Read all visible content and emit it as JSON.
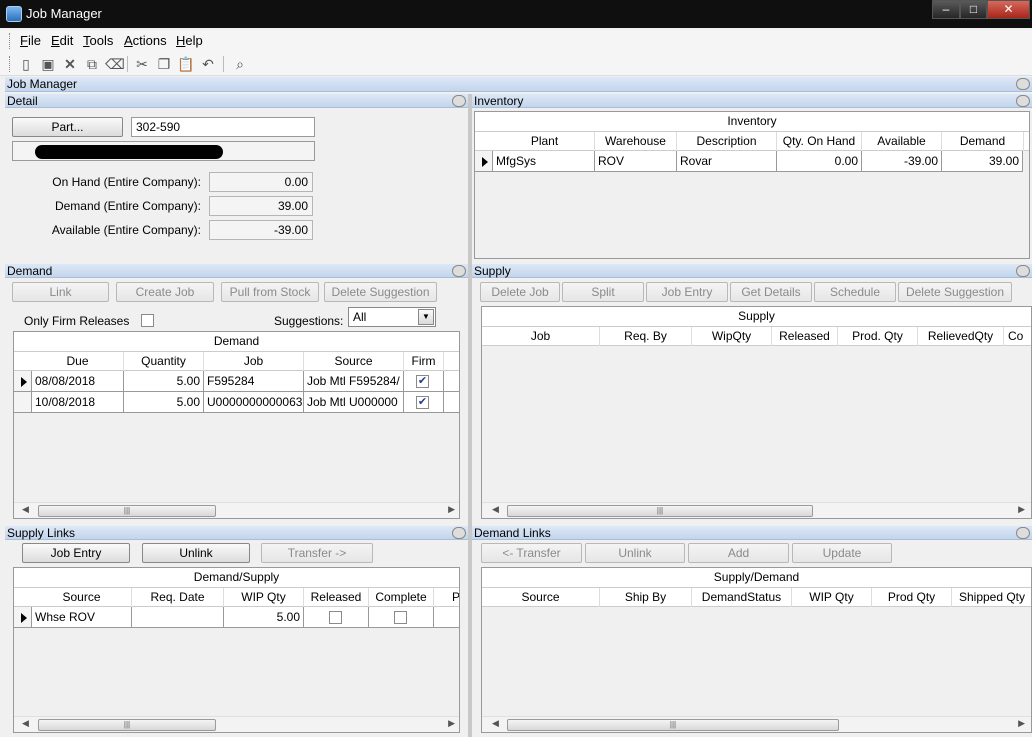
{
  "window": {
    "title": "Job Manager"
  },
  "menu": [
    "File",
    "Edit",
    "Tools",
    "Actions",
    "Help"
  ],
  "toolbar_icons": [
    "new-icon",
    "save-icon",
    "delete-icon",
    "attach-icon",
    "clear-icon",
    "cut-icon",
    "copy-icon",
    "paste-icon",
    "undo-icon",
    "find-icon"
  ],
  "main_header": "Job Manager",
  "detail": {
    "header": "Detail",
    "part_button": "Part...",
    "part_value": "302-590",
    "on_hand_label": "On Hand (Entire Company):",
    "on_hand": "0.00",
    "demand_label": "Demand (Entire Company):",
    "demand": "39.00",
    "available_label": "Available (Entire Company):",
    "available": "-39.00"
  },
  "inventory": {
    "header": "Inventory",
    "caption": "Inventory",
    "columns": [
      "Plant",
      "Warehouse",
      "Description",
      "Qty. On Hand",
      "Available",
      "Demand"
    ],
    "rows": [
      {
        "plant": "MfgSys",
        "warehouse": "ROV",
        "description": "Rovar",
        "qty_on_hand": "0.00",
        "available": "-39.00",
        "demand": "39.00"
      }
    ]
  },
  "demand": {
    "header": "Demand",
    "buttons": [
      "Link",
      "Create Job",
      "Pull from Stock",
      "Delete Suggestion"
    ],
    "only_firm_label": "Only Firm Releases",
    "suggestions_label": "Suggestions:",
    "suggestions_value": "All",
    "caption": "Demand",
    "columns": [
      "Due",
      "Quantity",
      "Job",
      "Source",
      "Firm"
    ],
    "rows": [
      {
        "due": "08/08/2018",
        "quantity": "5.00",
        "job": "F595284",
        "source": "Job Mtl F595284/",
        "firm": true
      },
      {
        "due": "10/08/2018",
        "quantity": "5.00",
        "job": "U0000000000063",
        "source": "Job Mtl U000000",
        "firm": true
      }
    ]
  },
  "supply": {
    "header": "Supply",
    "buttons": [
      "Delete Job",
      "Split",
      "Job Entry",
      "Get Details",
      "Schedule",
      "Delete Suggestion"
    ],
    "caption": "Supply",
    "columns": [
      "Job",
      "Req. By",
      "WipQty",
      "Released",
      "Prod. Qty",
      "RelievedQty",
      "Co"
    ]
  },
  "supply_links": {
    "header": "Supply Links",
    "buttons": [
      "Job Entry",
      "Unlink",
      "Transfer ->"
    ],
    "caption": "Demand/Supply",
    "columns": [
      "Source",
      "Req. Date",
      "WIP Qty",
      "Released",
      "Complete",
      "P"
    ],
    "rows": [
      {
        "source": "Whse ROV",
        "req_date": "",
        "wip_qty": "5.00",
        "released": false,
        "complete": false
      }
    ]
  },
  "demand_links": {
    "header": "Demand Links",
    "buttons": [
      "<- Transfer",
      "Unlink",
      "Add",
      "Update"
    ],
    "caption": "Supply/Demand",
    "columns": [
      "Source",
      "Ship By",
      "DemandStatus",
      "WIP Qty",
      "Prod Qty",
      "Shipped Qty"
    ]
  }
}
